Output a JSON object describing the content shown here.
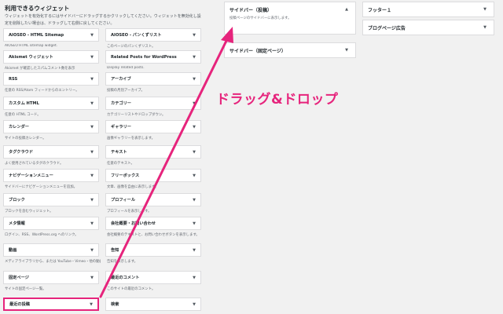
{
  "available": {
    "heading": "利用できるウィジェット",
    "intro_line1": "ウィジェットを有効化するにはサイドバーにドラッグするかクリックしてください。ウィジェットを無効化し設",
    "intro_line2": "定を削除したい場合は、ドラッグして右側に戻してください。",
    "widgets": [
      {
        "label": "AIOSEO - HTML Sitemap",
        "desc": "AIOSEO HTML sitemap widget."
      },
      {
        "label": "AIOSEO - パンくずリスト",
        "desc": "このページのパンくずリスト。"
      },
      {
        "label": "Akismet ウィジェット",
        "desc": "Akismet が確認したスパムコメント数を表示"
      },
      {
        "label": "Related Posts for WordPress",
        "desc": "Display related posts."
      },
      {
        "label": "RSS",
        "desc": "任意の RSS/Atom フィードからのエントリー。"
      },
      {
        "label": "アーカイブ",
        "desc": "投稿の月別アーカイブ。"
      },
      {
        "label": "カスタム HTML",
        "desc": "任意の HTML コード。"
      },
      {
        "label": "カテゴリー",
        "desc": "カテゴリーリストやドロップダウン。"
      },
      {
        "label": "カレンダー",
        "desc": "サイトの投稿カレンダー。"
      },
      {
        "label": "ギャラリー",
        "desc": "画像ギャラリーを表示します。"
      },
      {
        "label": "タグクラウド",
        "desc": "よく使用されているタグのクラウド。"
      },
      {
        "label": "テキスト",
        "desc": "任意のテキスト。"
      },
      {
        "label": "ナビゲーションメニュー",
        "desc": "サイドバーにナビゲーションメニューを追加。"
      },
      {
        "label": "フリーボックス",
        "desc": "文章、画像を自由に表示します。"
      },
      {
        "label": "ブロック",
        "desc": "ブロックを含むウィジェット。"
      },
      {
        "label": "プロフィール",
        "desc": "プロフィールを表示します。"
      },
      {
        "label": "メタ情報",
        "desc": "ログイン、RSS、WordPress.org へのリンク。"
      },
      {
        "label": "会社概要・お問い合わせ",
        "desc": "会社概要のテキストと、お問い合わせボタンを表示します。"
      },
      {
        "label": "動画",
        "desc": "メディアライブラリから、または YouTube・Vimeo・他の動画サービスから動画を表示します。"
      },
      {
        "label": "告知",
        "desc": "告知を表示します。"
      },
      {
        "label": "固定ページ",
        "desc": "サイトの固定ページ一覧。"
      },
      {
        "label": "最近のコメント",
        "desc": "このサイトの最近のコメント。"
      },
      {
        "label": "最近の投稿",
        "desc": ""
      },
      {
        "label": "検索",
        "desc": ""
      }
    ]
  },
  "areas": {
    "sidebar_post": {
      "title": "サイドバー（投稿）",
      "desc": "投稿ページのサイドバーに表示します。"
    },
    "sidebar_page": {
      "title": "サイドバー（固定ページ）"
    },
    "footer1": {
      "title": "フッター１"
    },
    "blog_ad": {
      "title": "ブログページ広告"
    }
  },
  "annotation": {
    "label": "ドラッグ&ドロップ",
    "color": "#e6247c"
  },
  "icons": {
    "toggle": "triangle-down-icon",
    "toggle_open": "triangle-up-icon",
    "arrow": "drag-arrow"
  }
}
